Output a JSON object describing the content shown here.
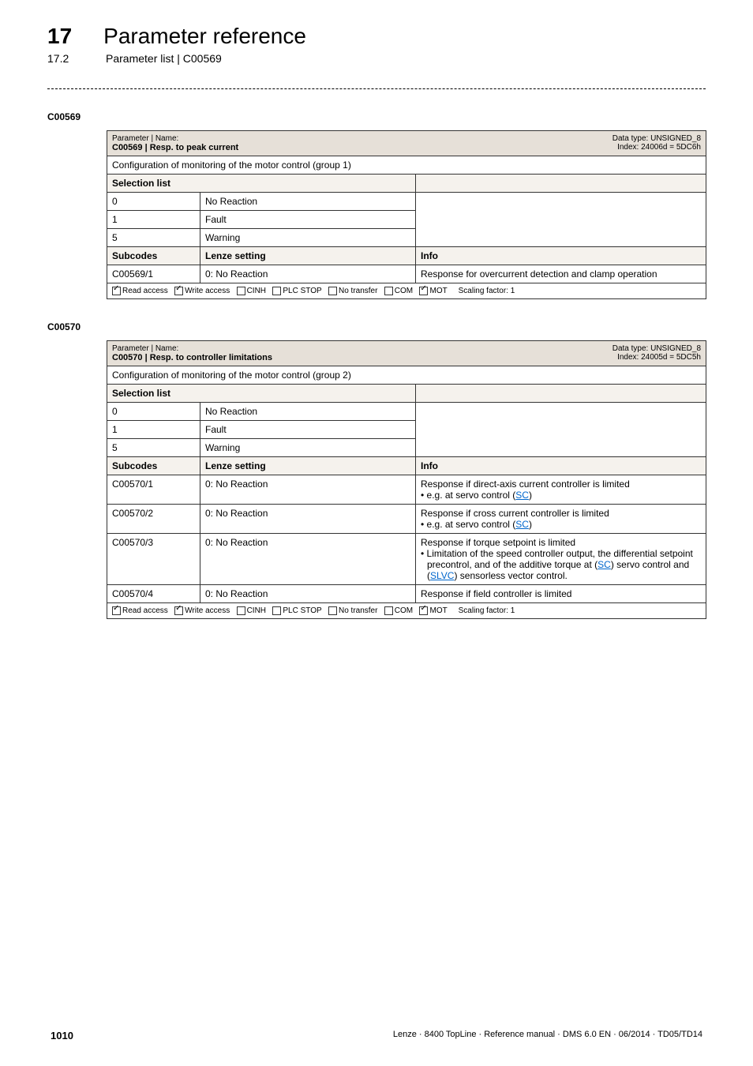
{
  "header": {
    "chapter_number": "17",
    "chapter_title": "Parameter reference",
    "sub_number": "17.2",
    "sub_title": "Parameter list | C00569"
  },
  "params": [
    {
      "code_label": "C00569",
      "name_line1": "Parameter | Name:",
      "name_line2": "C00569 | Resp. to peak current",
      "data_type": "Data type: UNSIGNED_8",
      "index": "Index: 24006d = 5DC6h",
      "description": "Configuration of monitoring of the motor control (group 1)",
      "selection_header": "Selection list",
      "selections": [
        {
          "num": "0",
          "text": "No Reaction"
        },
        {
          "num": "1",
          "text": "Fault"
        },
        {
          "num": "5",
          "text": "Warning"
        }
      ],
      "subcodes_header": {
        "c1": "Subcodes",
        "c2": "Lenze setting",
        "c3": "Info"
      },
      "subcodes": [
        {
          "c1": "C00569/1",
          "c2": "0: No Reaction",
          "c3": "Response for overcurrent detection and clamp operation"
        }
      ],
      "footer": {
        "read": "Read access",
        "write": "Write access",
        "cinh": "CINH",
        "plc": "PLC STOP",
        "notransfer": "No transfer",
        "com": "COM",
        "mot": "MOT",
        "scaling": "Scaling factor: 1"
      }
    },
    {
      "code_label": "C00570",
      "name_line1": "Parameter | Name:",
      "name_line2": "C00570 | Resp. to controller limitations",
      "data_type": "Data type: UNSIGNED_8",
      "index": "Index: 24005d = 5DC5h",
      "description": "Configuration of monitoring of the motor control (group 2)",
      "selection_header": "Selection list",
      "selections": [
        {
          "num": "0",
          "text": "No Reaction"
        },
        {
          "num": "1",
          "text": "Fault"
        },
        {
          "num": "5",
          "text": "Warning"
        }
      ],
      "subcodes_header": {
        "c1": "Subcodes",
        "c2": "Lenze setting",
        "c3": "Info"
      },
      "subcodes": [
        {
          "c1": "C00570/1",
          "c2": "0: No Reaction",
          "c3_main": "Response if direct-axis current controller is limited",
          "c3_bullet": "• e.g. at servo control (",
          "c3_link1": "SC",
          "c3_bullet_end": ")"
        },
        {
          "c1": "C00570/2",
          "c2": "0: No Reaction",
          "c3_main": "Response if cross current controller is limited",
          "c3_bullet": "• e.g. at servo control (",
          "c3_link1": "SC",
          "c3_bullet_end": ")"
        },
        {
          "c1": "C00570/3",
          "c2": "0: No Reaction",
          "c3_main": "Response if torque setpoint is limited",
          "c3_bullet": "• Limitation of the speed controller output, the differential setpoint precontrol, and of the additive torque at (",
          "c3_link1": "SC",
          "c3_mid": ") servo control and (",
          "c3_link2": "SLVC",
          "c3_bullet_end": ") sensorless vector control."
        },
        {
          "c1": "C00570/4",
          "c2": "0: No Reaction",
          "c3_main": "Response if field controller is limited"
        }
      ],
      "footer": {
        "read": "Read access",
        "write": "Write access",
        "cinh": "CINH",
        "plc": "PLC STOP",
        "notransfer": "No transfer",
        "com": "COM",
        "mot": "MOT",
        "scaling": "Scaling factor: 1"
      }
    }
  ],
  "chart_data": [
    {
      "type": "table",
      "title": "C00569 | Resp. to peak current",
      "data_type": "UNSIGNED_8",
      "index_dec": 24006,
      "index_hex": "5DC6",
      "description": "Configuration of monitoring of the motor control (group 1)",
      "selection_list": [
        {
          "value": 0,
          "label": "No Reaction"
        },
        {
          "value": 1,
          "label": "Fault"
        },
        {
          "value": 5,
          "label": "Warning"
        }
      ],
      "subcodes": [
        {
          "subcode": "C00569/1",
          "lenze_setting": "0: No Reaction",
          "info": "Response for overcurrent detection and clamp operation"
        }
      ],
      "access": {
        "read": true,
        "write": true,
        "cinh": false,
        "plc_stop": false,
        "no_transfer": false,
        "com": false,
        "mot": true
      },
      "scaling_factor": 1
    },
    {
      "type": "table",
      "title": "C00570 | Resp. to controller limitations",
      "data_type": "UNSIGNED_8",
      "index_dec": 24005,
      "index_hex": "5DC5",
      "description": "Configuration of monitoring of the motor control (group 2)",
      "selection_list": [
        {
          "value": 0,
          "label": "No Reaction"
        },
        {
          "value": 1,
          "label": "Fault"
        },
        {
          "value": 5,
          "label": "Warning"
        }
      ],
      "subcodes": [
        {
          "subcode": "C00570/1",
          "lenze_setting": "0: No Reaction",
          "info": "Response if direct-axis current controller is limited; e.g. at servo control (SC)"
        },
        {
          "subcode": "C00570/2",
          "lenze_setting": "0: No Reaction",
          "info": "Response if cross current controller is limited; e.g. at servo control (SC)"
        },
        {
          "subcode": "C00570/3",
          "lenze_setting": "0: No Reaction",
          "info": "Response if torque setpoint is limited; Limitation of the speed controller output, the differential setpoint precontrol, and of the additive torque at (SC) servo control and (SLVC) sensorless vector control."
        },
        {
          "subcode": "C00570/4",
          "lenze_setting": "0: No Reaction",
          "info": "Response if field controller is limited"
        }
      ],
      "access": {
        "read": true,
        "write": true,
        "cinh": false,
        "plc_stop": false,
        "no_transfer": false,
        "com": false,
        "mot": true
      },
      "scaling_factor": 1
    }
  ],
  "footer": {
    "page_number": "1010",
    "doc_info": "Lenze · 8400 TopLine · Reference manual · DMS 6.0 EN · 06/2014 · TD05/TD14"
  }
}
